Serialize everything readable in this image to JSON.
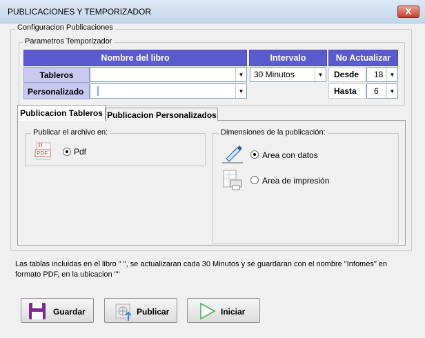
{
  "window": {
    "title": "PUBLICACIONES Y TEMPORIZADOR",
    "close_label": "X"
  },
  "config_group": {
    "legend": "Configuracion Publicaciones",
    "temporizador": {
      "legend": "Parametros Temporizador",
      "headers": {
        "libro": "Nombre del libro",
        "intervalo": "Intervalo",
        "no_actualizar": "No Actualizar"
      },
      "rows": [
        {
          "label": "Tableros",
          "libro_value": "",
          "intervalo_value": "30 Minutos",
          "na_label": "Desde",
          "na_value": "18"
        },
        {
          "label": "Personalizado",
          "libro_value": "",
          "na_label": "Hasta",
          "na_value": "6"
        }
      ]
    }
  },
  "tabs": [
    {
      "label": "Publicacion Tableros",
      "active": true
    },
    {
      "label": "Publicacion Personalizados",
      "active": false
    }
  ],
  "publicar_group": {
    "legend": "Publicar el archivo en:",
    "option_pdf": "Pdf",
    "icon_text": "PDF"
  },
  "dimensiones_group": {
    "legend": "Dimensiones de la publicación:",
    "option_area_datos": "Area con datos",
    "option_area_impresion": "Area de impresión",
    "selected": "area_datos"
  },
  "info": {
    "line1": "Las tablas incluidas en el libro \" \", se actualizaran cada 30 Minutos y se guardaran con el nombre \"Infomes\" en",
    "line2": "formato PDF, en la ubicacion \"\""
  },
  "buttons": {
    "guardar": "Guardar",
    "publicar": "Publicar",
    "iniciar": "Iniciar"
  },
  "colors": {
    "header_blue": "#5b5bd0",
    "row_label": "#c9c9f0",
    "save_icon": "#7a2a8c",
    "play_icon": "#4caf50"
  }
}
